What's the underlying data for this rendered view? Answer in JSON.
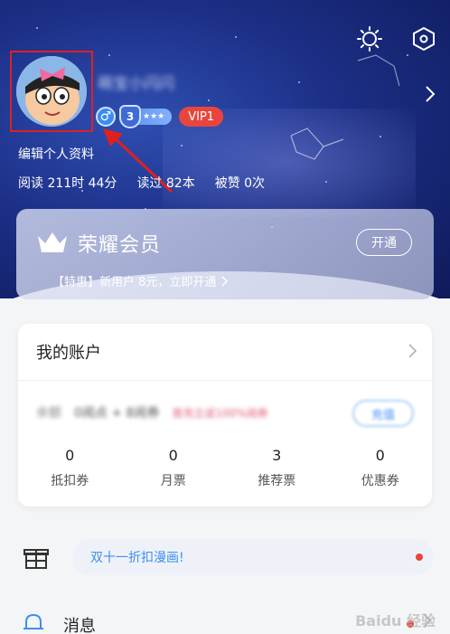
{
  "header": {
    "username": "萌宝小闪闪",
    "badges": {
      "gender": "♂",
      "level": "3",
      "level_stars": "★★★",
      "vip": "VIP1"
    },
    "edit_profile": "编辑个人资料",
    "stats": {
      "read_time": "阅读 211时 44分",
      "books_read": "读过 82本",
      "likes": "被赞 0次"
    },
    "icons": {
      "settings": "gear-icon",
      "skin": "hexagon-icon"
    }
  },
  "vip_card": {
    "title": "荣耀会员",
    "open_label": "开通",
    "promo": "【特惠】新用户 8元，立即开通"
  },
  "account": {
    "title": "我的账户",
    "balance_label": "余额",
    "balance_value": "0阅点 + 8阅券",
    "recharge_promo": "首充立返100%阅券",
    "recharge_label": "充值",
    "tickets": [
      {
        "value": "0",
        "label": "抵扣券"
      },
      {
        "value": "0",
        "label": "月票"
      },
      {
        "value": "3",
        "label": "推荐票"
      },
      {
        "value": "0",
        "label": "优惠券"
      }
    ]
  },
  "promo_banner": {
    "text": "双十一折扣漫画!"
  },
  "messages": {
    "label": "消息"
  },
  "watermark": "Baidu 经验"
}
